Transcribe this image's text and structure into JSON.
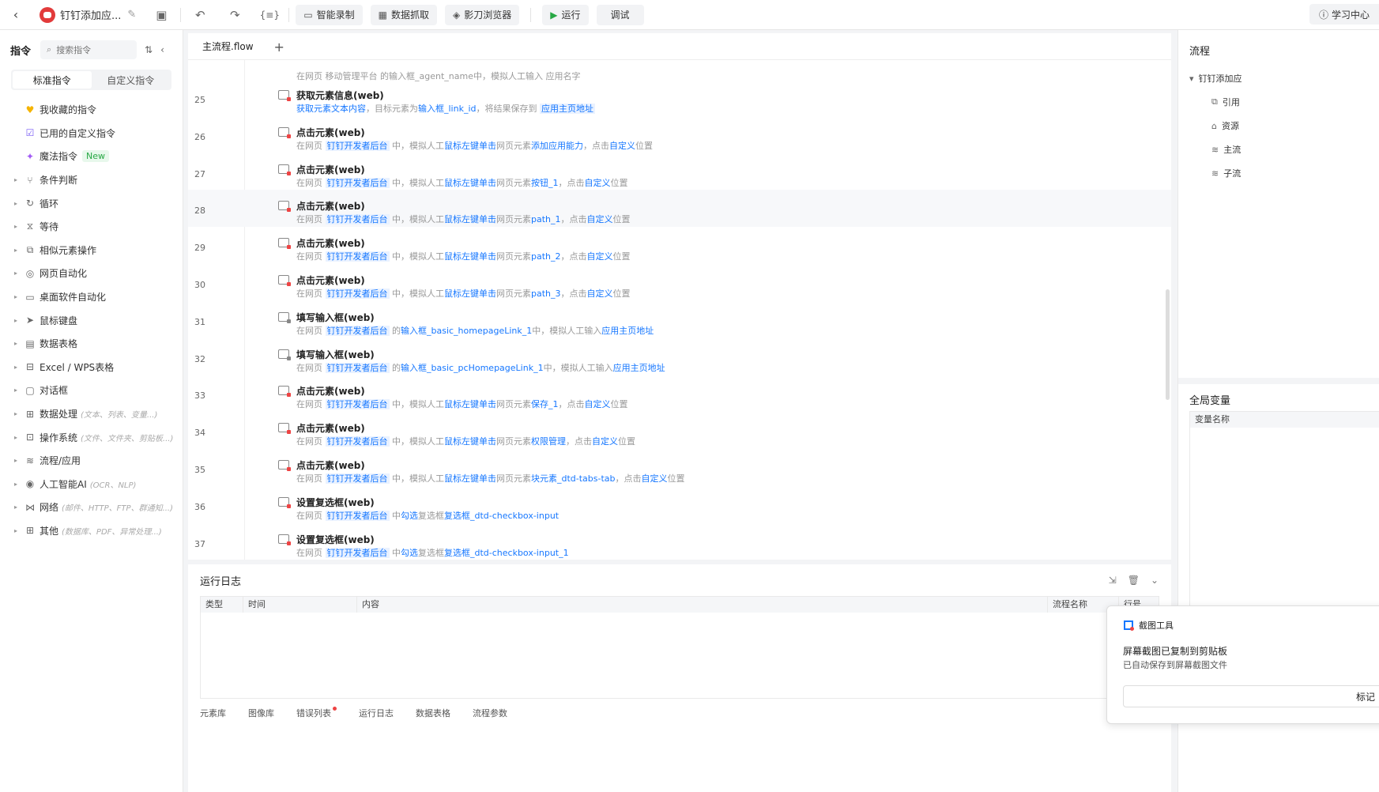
{
  "topbar": {
    "back_icon": "back-icon",
    "title": "钉钉添加应...",
    "buttons": {
      "smart_record": "智能录制",
      "data_capture": "数据抓取",
      "browser": "影刀浏览器",
      "run": "运行",
      "debug": "调试"
    },
    "learning_center": "学习中心"
  },
  "left_panel": {
    "title": "指令",
    "search_placeholder": "搜索指令",
    "tabs": [
      "标准指令",
      "自定义指令"
    ],
    "items": [
      {
        "label": "我收藏的指令",
        "hint": "",
        "icon": "heart-icon",
        "arrow": false
      },
      {
        "label": "已用的自定义指令",
        "hint": "",
        "icon": "calendar-check-icon",
        "arrow": false
      },
      {
        "label": "魔法指令",
        "hint": "",
        "icon": "sparkle-icon",
        "arrow": false,
        "badge": "New"
      },
      {
        "label": "条件判断",
        "hint": "",
        "icon": "branch-icon",
        "arrow": true
      },
      {
        "label": "循环",
        "hint": "",
        "icon": "loop-icon",
        "arrow": true
      },
      {
        "label": "等待",
        "hint": "",
        "icon": "hourglass-icon",
        "arrow": true
      },
      {
        "label": "相似元素操作",
        "hint": "",
        "icon": "copy-icon",
        "arrow": true
      },
      {
        "label": "网页自动化",
        "hint": "",
        "icon": "globe-icon",
        "arrow": true
      },
      {
        "label": "桌面软件自动化",
        "hint": "",
        "icon": "monitor-icon",
        "arrow": true
      },
      {
        "label": "鼠标键盘",
        "hint": "",
        "icon": "cursor-icon",
        "arrow": true
      },
      {
        "label": "数据表格",
        "hint": "",
        "icon": "document-icon",
        "arrow": true
      },
      {
        "label": "Excel / WPS表格",
        "hint": "",
        "icon": "excel-icon",
        "arrow": true
      },
      {
        "label": "对话框",
        "hint": "",
        "icon": "dialog-icon",
        "arrow": true
      },
      {
        "label": "数据处理",
        "hint": "(文本、列表、变量...)",
        "icon": "data-icon",
        "arrow": true
      },
      {
        "label": "操作系统",
        "hint": "(文件、文件夹、剪贴板...)",
        "icon": "os-icon",
        "arrow": true
      },
      {
        "label": "流程/应用",
        "hint": "",
        "icon": "layers-icon",
        "arrow": true
      },
      {
        "label": "人工智能AI",
        "hint": "(OCR、NLP)",
        "icon": "ai-icon",
        "arrow": true
      },
      {
        "label": "网络",
        "hint": "(邮件、HTTP、FTP、群通知...)",
        "icon": "network-icon",
        "arrow": true
      },
      {
        "label": "其他",
        "hint": "(数据库、PDF、异常处理...)",
        "icon": "grid-icon",
        "arrow": true
      }
    ]
  },
  "editor": {
    "tab": "主流程.flow",
    "first_line": "在网页 移动管理平台 的输入框_agent_name中，模拟人工输入 应用名字",
    "rows": [
      {
        "line": "25",
        "title": "获取元素信息(web)",
        "kind": "click",
        "desc": [
          {
            "t": "获取元素文本内容",
            "c": "link"
          },
          {
            "t": "，目标元素为",
            "c": ""
          },
          {
            "t": "输入框_link_id",
            "c": "link"
          },
          {
            "t": "，将结果保存到 ",
            "c": ""
          },
          {
            "t": "应用主页地址",
            "c": "tag"
          }
        ]
      },
      {
        "line": "26",
        "title": "点击元素(web)",
        "kind": "click",
        "desc": [
          {
            "t": "在网页 ",
            "c": ""
          },
          {
            "t": "钉钉开发者后台",
            "c": "tag"
          },
          {
            "t": " 中，模拟人工",
            "c": ""
          },
          {
            "t": "鼠标左键单击",
            "c": "link"
          },
          {
            "t": "网页元素",
            "c": ""
          },
          {
            "t": "添加应用能力",
            "c": "link"
          },
          {
            "t": "，点击",
            "c": ""
          },
          {
            "t": "自定义",
            "c": "link"
          },
          {
            "t": "位置",
            "c": ""
          }
        ]
      },
      {
        "line": "27",
        "title": "点击元素(web)",
        "kind": "click",
        "desc": [
          {
            "t": "在网页 ",
            "c": ""
          },
          {
            "t": "钉钉开发者后台",
            "c": "tag"
          },
          {
            "t": " 中，模拟人工",
            "c": ""
          },
          {
            "t": "鼠标左键单击",
            "c": "link"
          },
          {
            "t": "网页元素",
            "c": ""
          },
          {
            "t": "按钮_1",
            "c": "link"
          },
          {
            "t": "，点击",
            "c": ""
          },
          {
            "t": "自定义",
            "c": "link"
          },
          {
            "t": "位置",
            "c": ""
          }
        ]
      },
      {
        "line": "28",
        "title": "点击元素(web)",
        "kind": "click",
        "highlight": true,
        "desc": [
          {
            "t": "在网页 ",
            "c": ""
          },
          {
            "t": "钉钉开发者后台",
            "c": "tag"
          },
          {
            "t": " 中，模拟人工",
            "c": ""
          },
          {
            "t": "鼠标左键单击",
            "c": "link"
          },
          {
            "t": "网页元素",
            "c": ""
          },
          {
            "t": "path_1",
            "c": "link"
          },
          {
            "t": "，点击",
            "c": ""
          },
          {
            "t": "自定义",
            "c": "link"
          },
          {
            "t": "位置",
            "c": ""
          }
        ]
      },
      {
        "line": "29",
        "title": "点击元素(web)",
        "kind": "click",
        "desc": [
          {
            "t": "在网页 ",
            "c": ""
          },
          {
            "t": "钉钉开发者后台",
            "c": "tag"
          },
          {
            "t": " 中，模拟人工",
            "c": ""
          },
          {
            "t": "鼠标左键单击",
            "c": "link"
          },
          {
            "t": "网页元素",
            "c": ""
          },
          {
            "t": "path_2",
            "c": "link"
          },
          {
            "t": "，点击",
            "c": ""
          },
          {
            "t": "自定义",
            "c": "link"
          },
          {
            "t": "位置",
            "c": ""
          }
        ]
      },
      {
        "line": "30",
        "title": "点击元素(web)",
        "kind": "click",
        "desc": [
          {
            "t": "在网页 ",
            "c": ""
          },
          {
            "t": "钉钉开发者后台",
            "c": "tag"
          },
          {
            "t": " 中，模拟人工",
            "c": ""
          },
          {
            "t": "鼠标左键单击",
            "c": "link"
          },
          {
            "t": "网页元素",
            "c": ""
          },
          {
            "t": "path_3",
            "c": "link"
          },
          {
            "t": "，点击",
            "c": ""
          },
          {
            "t": "自定义",
            "c": "link"
          },
          {
            "t": "位置",
            "c": ""
          }
        ]
      },
      {
        "line": "31",
        "title": "填写输入框(web)",
        "kind": "input",
        "desc": [
          {
            "t": "在网页 ",
            "c": ""
          },
          {
            "t": "钉钉开发者后台",
            "c": "tag"
          },
          {
            "t": " 的",
            "c": ""
          },
          {
            "t": "输入框_basic_homepageLink_1",
            "c": "link"
          },
          {
            "t": "中，模拟人工输入",
            "c": ""
          },
          {
            "t": "应用主页地址",
            "c": "link"
          }
        ]
      },
      {
        "line": "32",
        "title": "填写输入框(web)",
        "kind": "input",
        "desc": [
          {
            "t": "在网页 ",
            "c": ""
          },
          {
            "t": "钉钉开发者后台",
            "c": "tag"
          },
          {
            "t": " 的",
            "c": ""
          },
          {
            "t": "输入框_basic_pcHomepageLink_1",
            "c": "link"
          },
          {
            "t": "中，模拟人工输入",
            "c": ""
          },
          {
            "t": "应用主页地址",
            "c": "link"
          }
        ]
      },
      {
        "line": "33",
        "title": "点击元素(web)",
        "kind": "click",
        "desc": [
          {
            "t": "在网页 ",
            "c": ""
          },
          {
            "t": "钉钉开发者后台",
            "c": "tag"
          },
          {
            "t": " 中，模拟人工",
            "c": ""
          },
          {
            "t": "鼠标左键单击",
            "c": "link"
          },
          {
            "t": "网页元素",
            "c": ""
          },
          {
            "t": "保存_1",
            "c": "link"
          },
          {
            "t": "，点击",
            "c": ""
          },
          {
            "t": "自定义",
            "c": "link"
          },
          {
            "t": "位置",
            "c": ""
          }
        ]
      },
      {
        "line": "34",
        "title": "点击元素(web)",
        "kind": "click",
        "desc": [
          {
            "t": "在网页 ",
            "c": ""
          },
          {
            "t": "钉钉开发者后台",
            "c": "tag"
          },
          {
            "t": " 中，模拟人工",
            "c": ""
          },
          {
            "t": "鼠标左键单击",
            "c": "link"
          },
          {
            "t": "网页元素",
            "c": ""
          },
          {
            "t": "权限管理",
            "c": "link"
          },
          {
            "t": "，点击",
            "c": ""
          },
          {
            "t": "自定义",
            "c": "link"
          },
          {
            "t": "位置",
            "c": ""
          }
        ]
      },
      {
        "line": "35",
        "title": "点击元素(web)",
        "kind": "click",
        "desc": [
          {
            "t": "在网页 ",
            "c": ""
          },
          {
            "t": "钉钉开发者后台",
            "c": "tag"
          },
          {
            "t": " 中，模拟人工",
            "c": ""
          },
          {
            "t": "鼠标左键单击",
            "c": "link"
          },
          {
            "t": "网页元素",
            "c": ""
          },
          {
            "t": "块元素_dtd-tabs-tab",
            "c": "link"
          },
          {
            "t": "，点击",
            "c": ""
          },
          {
            "t": "自定义",
            "c": "link"
          },
          {
            "t": "位置",
            "c": ""
          }
        ]
      },
      {
        "line": "36",
        "title": "设置复选框(web)",
        "kind": "checkbox",
        "desc": [
          {
            "t": "在网页 ",
            "c": ""
          },
          {
            "t": "钉钉开发者后台",
            "c": "tag"
          },
          {
            "t": " 中",
            "c": ""
          },
          {
            "t": "勾选",
            "c": "link"
          },
          {
            "t": "复选框",
            "c": ""
          },
          {
            "t": "复选框_dtd-checkbox-input",
            "c": "link"
          }
        ]
      },
      {
        "line": "37",
        "title": "设置复选框(web)",
        "kind": "checkbox",
        "desc": [
          {
            "t": "在网页 ",
            "c": ""
          },
          {
            "t": "钉钉开发者后台",
            "c": "tag"
          },
          {
            "t": " 中",
            "c": ""
          },
          {
            "t": "勾选",
            "c": "link"
          },
          {
            "t": "复选框",
            "c": ""
          },
          {
            "t": "复选框_dtd-checkbox-input_1",
            "c": "link"
          }
        ]
      }
    ]
  },
  "log": {
    "title": "运行日志",
    "columns": [
      "类型",
      "时间",
      "内容",
      "流程名称",
      "行号"
    ],
    "footer_tabs": [
      "元素库",
      "图像库",
      "错误列表",
      "运行日志",
      "数据表格",
      "流程参数"
    ]
  },
  "right_panel": {
    "title": "流程",
    "tree_root": "钉钉添加应",
    "tree_children": [
      "引用",
      "资源",
      "主流",
      "子流"
    ],
    "global_vars": "全局变量",
    "var_column": "变量名称"
  },
  "toast": {
    "app": "截图工具",
    "heading": "屏幕截图已复制到剪贴板",
    "body": "已自动保存到屏幕截图文件",
    "button": "标记"
  }
}
